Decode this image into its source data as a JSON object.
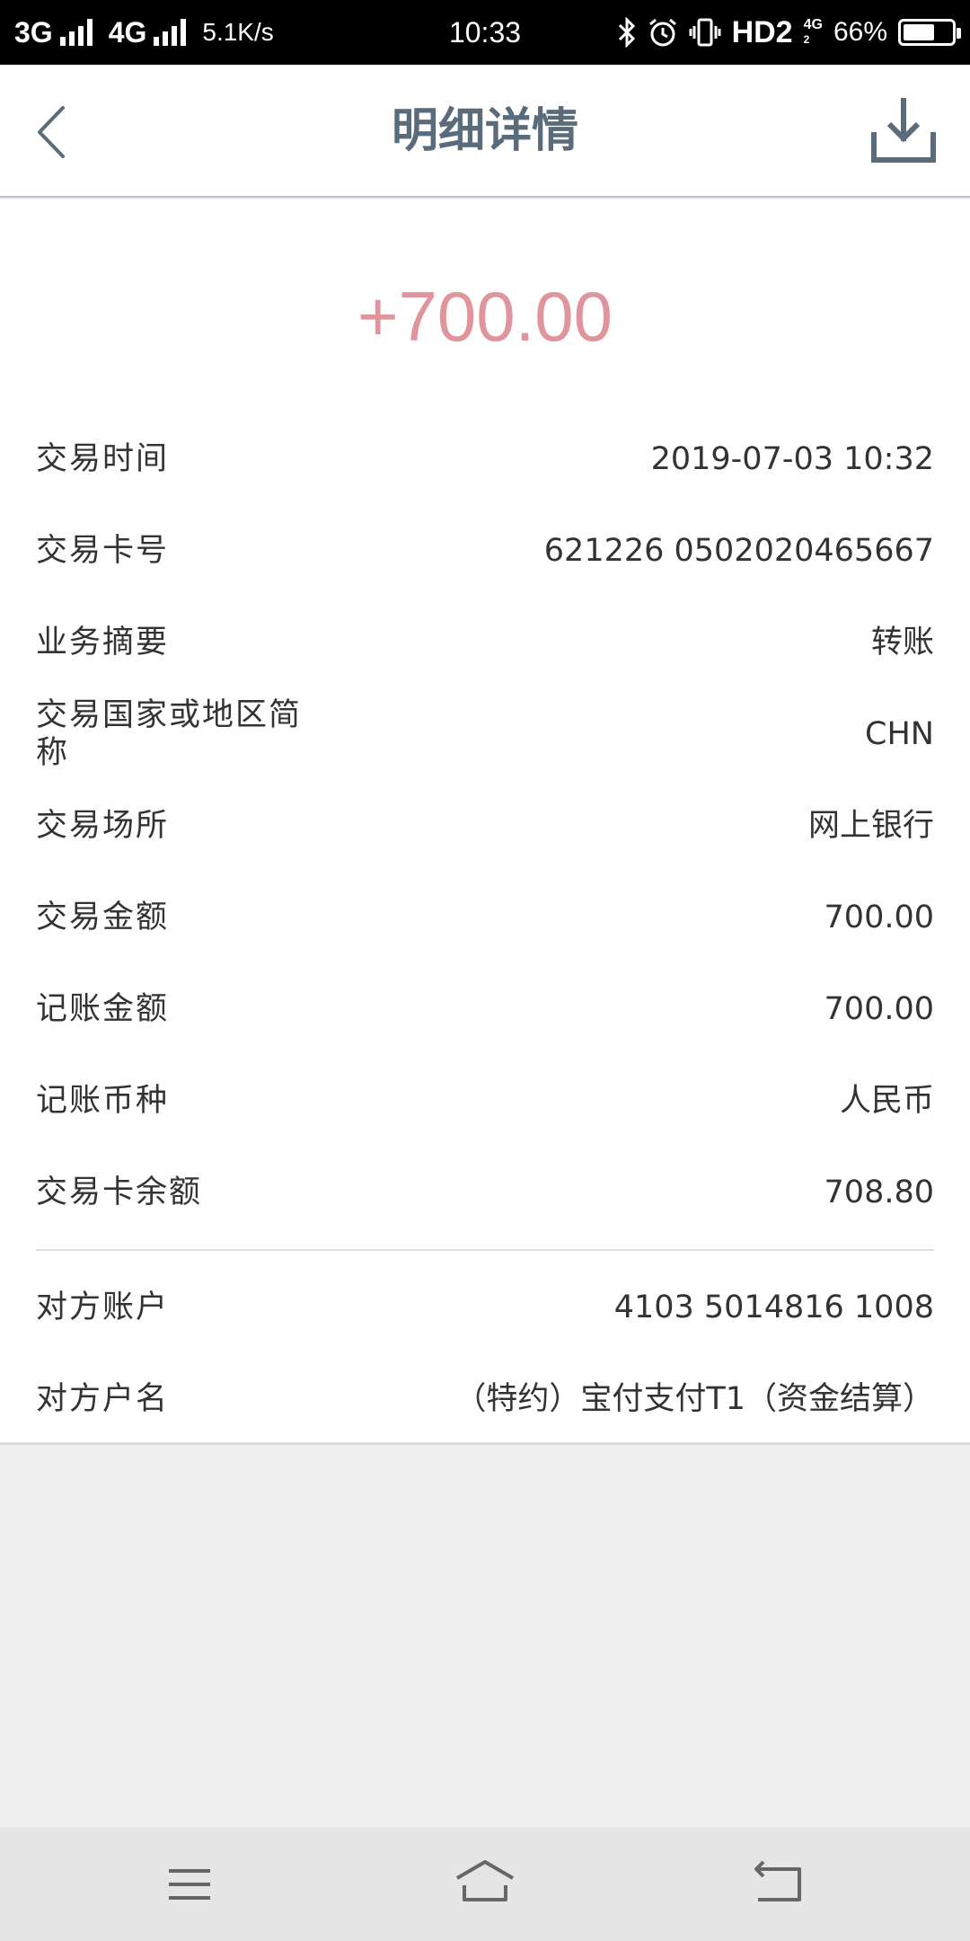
{
  "status_bar": {
    "net1": "3G",
    "net2": "4G",
    "speed": "5.1K/s",
    "time": "10:33",
    "hd": "HD2",
    "net3_top": "4G",
    "net3_sub": "2",
    "battery_text": "66%",
    "battery_level": 0.66
  },
  "header": {
    "title": "明细详情"
  },
  "detail": {
    "amount": "+700.00",
    "amount_color": "#e0949c",
    "rows": [
      {
        "label": "交易时间",
        "value": "2019-07-03 10:32"
      },
      {
        "label": "交易卡号",
        "value": "621226 0502020465667"
      },
      {
        "label": "业务摘要",
        "value": "转账"
      },
      {
        "label": "交易国家或地区简称",
        "value": "CHN"
      },
      {
        "label": "交易场所",
        "value": "网上银行"
      },
      {
        "label": "交易金额",
        "value": "700.00"
      },
      {
        "label": "记账金额",
        "value": "700.00"
      },
      {
        "label": "记账币种",
        "value": "人民币"
      },
      {
        "label": "交易卡余额",
        "value": "708.80"
      }
    ],
    "counterparty_rows": [
      {
        "label": "对方账户",
        "value": "4103 5014816 1008"
      },
      {
        "label": "对方户名",
        "value": "（特约）宝付支付T1（资金结算）"
      }
    ]
  },
  "icons": {
    "back": "chevron-left-icon",
    "download": "download-icon",
    "menu": "menu-icon",
    "home": "home-icon",
    "return": "return-icon"
  }
}
